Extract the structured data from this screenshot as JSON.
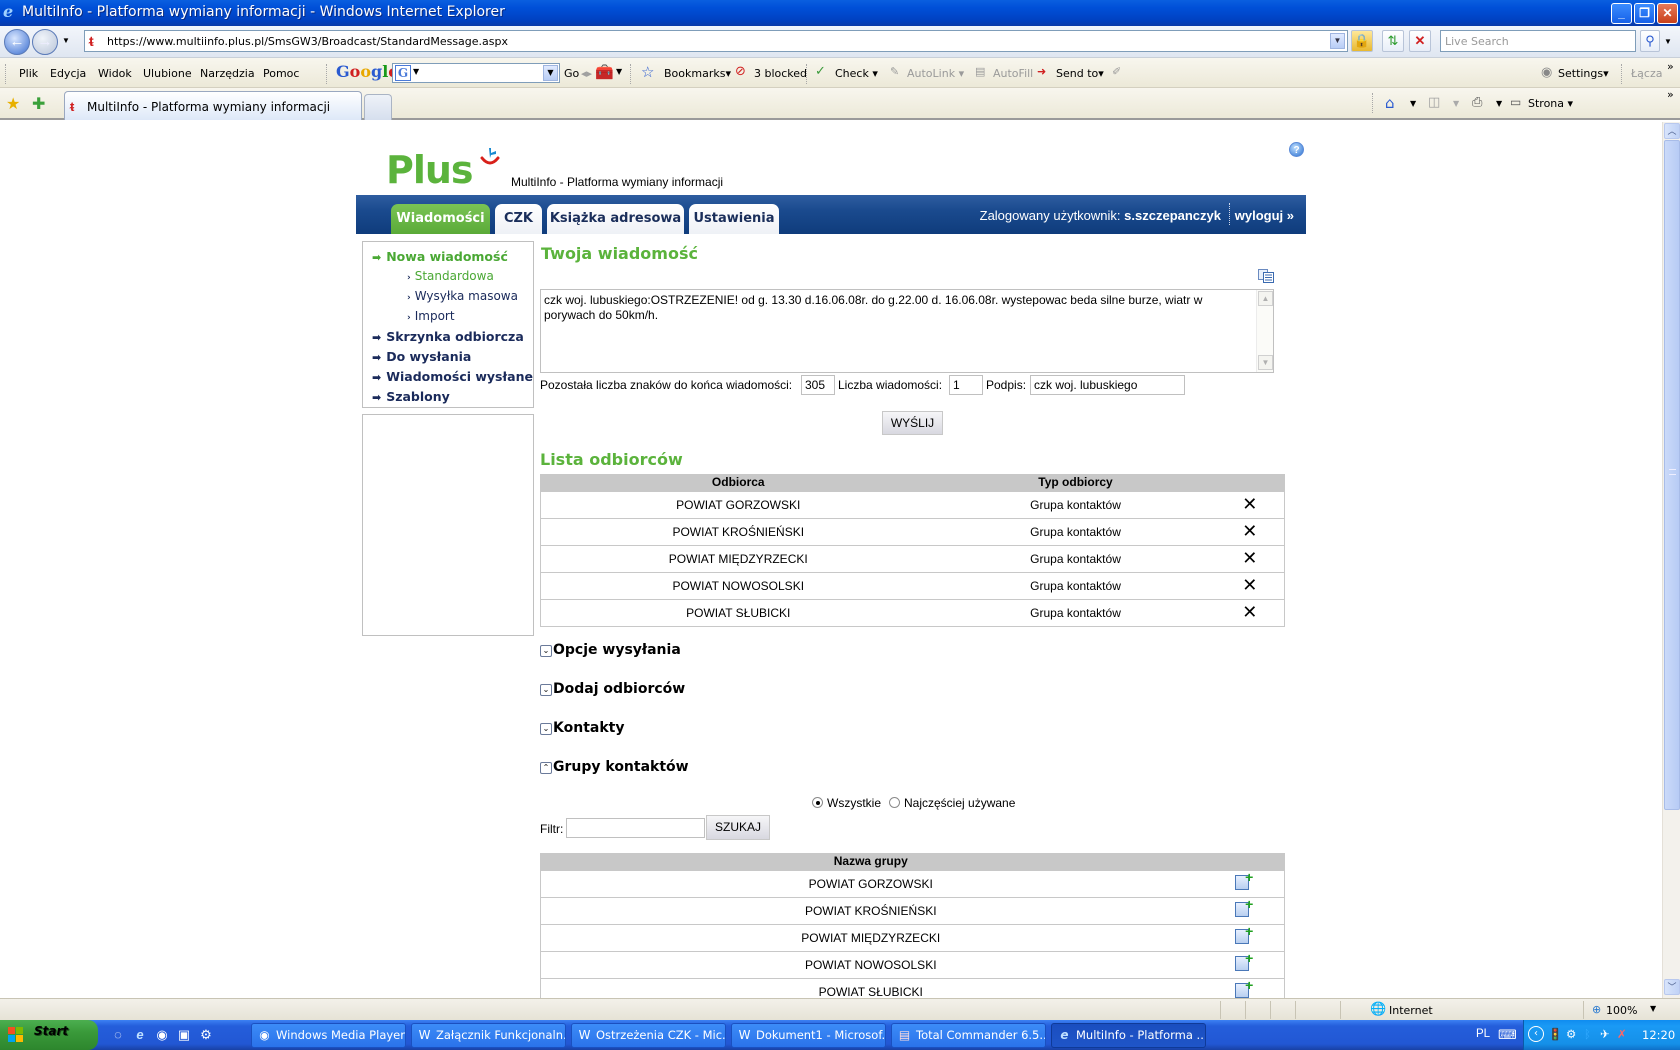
{
  "window": {
    "title": "MultiInfo - Platforma wymiany informacji - Windows Internet Explorer",
    "controls": [
      "minimize",
      "restore",
      "close"
    ]
  },
  "address_bar": {
    "url": "https://www.multiinfo.plus.pl/SmsGW3/Broadcast/StandardMessage.aspx",
    "search_placeholder": "Live Search"
  },
  "menu": {
    "items": [
      "Plik",
      "Edycja",
      "Widok",
      "Ulubione",
      "Narzędzia",
      "Pomoc"
    ]
  },
  "google_toolbar": {
    "logo": "Google",
    "go_label": "Go",
    "bookmarks_label": "Bookmarks",
    "blocked_label": "3 blocked",
    "check_label": "Check",
    "autolink_label": "AutoLink",
    "autofill_label": "AutoFill",
    "sendto_label": "Send to",
    "settings_label": "Settings",
    "links_label": "Łącza"
  },
  "tabs": {
    "active_label": "MultiInfo - Platforma wymiany informacji",
    "strona_label": "Strona"
  },
  "page": {
    "logo_text": "Plus",
    "subtitle": "MultiInfo - Platforma wymiany informacji",
    "nav_tabs": [
      {
        "label": "Wiadomości",
        "active": true
      },
      {
        "label": "CZK",
        "active": false
      },
      {
        "label": "Książka adresowa",
        "active": false
      },
      {
        "label": "Ustawienia",
        "active": false
      }
    ],
    "user_label": "Zalogowany użytkownik:",
    "username": "s.szczepanczyk",
    "logout_label": "wyloguj »",
    "sidebar": {
      "new_message": "Nowa wiadomość",
      "sub_items": [
        "Standardowa",
        "Wysyłka masowa",
        "Import"
      ],
      "items": [
        "Skrzynka odbiorcza",
        "Do wysłania",
        "Wiadomości wysłane",
        "Szablony"
      ]
    },
    "message": {
      "heading": "Twoja wiadomość",
      "text": "czk woj. lubuskiego:OSTRZEZENIE! od g. 13.30 d.16.06.08r. do g.22.00 d. 16.06.08r. wystepowac beda silne burze, wiatr w porywach do 50km/h.",
      "remaining_label": "Pozostała liczba znaków do końca wiadomości:",
      "remaining_value": "305",
      "count_label": "Liczba wiadomości:",
      "count_value": "1",
      "signature_label": "Podpis:",
      "signature_value": "czk woj. lubuskiego",
      "send_label": "WYŚLIJ"
    },
    "recipients": {
      "heading": "Lista odbiorców",
      "columns": [
        "Odbiorca",
        "Typ odbiorcy"
      ],
      "rows": [
        {
          "name": "POWIAT GORZOWSKI",
          "type": "Grupa kontaktów"
        },
        {
          "name": "POWIAT KROŚNIEŃSKI",
          "type": "Grupa kontaktów"
        },
        {
          "name": "POWIAT MIĘDZYRZECKI",
          "type": "Grupa kontaktów"
        },
        {
          "name": "POWIAT NOWOSOLSKI",
          "type": "Grupa kontaktów"
        },
        {
          "name": "POWIAT SŁUBICKI",
          "type": "Grupa kontaktów"
        }
      ]
    },
    "sections": [
      {
        "label": "Opcje wysyłania",
        "expanded": false
      },
      {
        "label": "Dodaj odbiorców",
        "expanded": false
      },
      {
        "label": "Kontakty",
        "expanded": false
      },
      {
        "label": "Grupy kontaktów",
        "expanded": true
      }
    ],
    "groups": {
      "radio_all": "Wszystkie",
      "radio_frequent": "Najczęściej używane",
      "selected_radio": "Wszystkie",
      "filter_label": "Filtr:",
      "filter_value": "",
      "search_label": "SZUKAJ",
      "column": "Nazwa grupy",
      "rows": [
        "POWIAT GORZOWSKI",
        "POWIAT KROŚNIEŃSKI",
        "POWIAT MIĘDZYRZECKI",
        "POWIAT NOWOSOLSKI",
        "POWIAT SŁUBICKI"
      ]
    }
  },
  "status_bar": {
    "zone": "Internet",
    "zoom": "100%"
  },
  "taskbar": {
    "start_label": "Start",
    "items": [
      {
        "label": "Windows Media Player",
        "icon": "media-player-icon",
        "active": false
      },
      {
        "label": "Załącznik Funkcjonaln...",
        "icon": "word-icon",
        "active": false
      },
      {
        "label": "Ostrzeżenia CZK - Mic...",
        "icon": "word-icon",
        "active": false
      },
      {
        "label": "Dokument1 - Microsof...",
        "icon": "word-icon",
        "active": false
      },
      {
        "label": "Total Commander 6.5...",
        "icon": "total-commander-icon",
        "active": false
      },
      {
        "label": "MultiInfo - Platforma ...",
        "icon": "ie-icon",
        "active": true
      }
    ],
    "language": "PL",
    "clock": "12:20"
  },
  "colors": {
    "brand_green": "#5bb33c",
    "nav_blue": "#1a4a8e",
    "sidebar_text": "#1a2a5a",
    "table_header": "#c8c8c8"
  }
}
